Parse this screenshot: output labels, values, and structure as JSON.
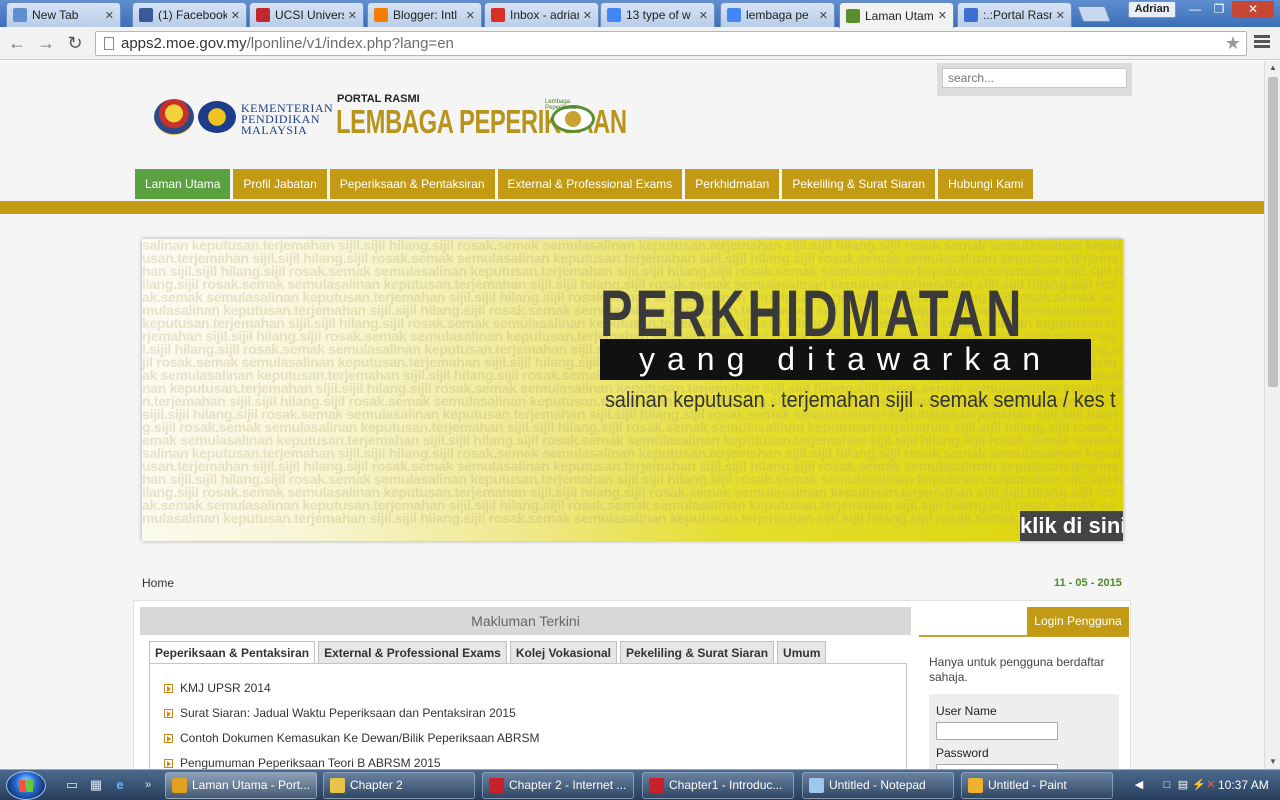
{
  "browser": {
    "tabs": [
      {
        "title": "New Tab",
        "icon": "blank-page-icon",
        "color": "#5f8fd0"
      },
      {
        "title": "(1) Facebook",
        "icon": "facebook-icon",
        "color": "#3b5998"
      },
      {
        "title": "UCSI University",
        "icon": "ucsi-icon",
        "color": "#c0282d"
      },
      {
        "title": "Blogger: Intl",
        "icon": "blogger-icon",
        "color": "#f57d00"
      },
      {
        "title": "Inbox - adrian",
        "icon": "gmail-icon",
        "color": "#d93025"
      },
      {
        "title": "13 type of w",
        "icon": "google-icon",
        "color": "#4285f4"
      },
      {
        "title": "lembaga pe",
        "icon": "google-icon",
        "color": "#4285f4"
      },
      {
        "title": "Laman Utama",
        "icon": "lp-site-icon",
        "color": "#5a8f2e"
      },
      {
        "title": ":.:Portal Rasmi",
        "icon": "loading-icon",
        "color": "#3b6fd0"
      }
    ],
    "active_tab_index": 7,
    "profile_name": "Adrian",
    "url_host": "apps2.moe.gov.my",
    "url_path": "/lponline/v1/index.php?lang=en"
  },
  "site": {
    "logo": {
      "kpm_line1": "KEMENTERIAN",
      "kpm_line2": "PENDIDIKAN",
      "kpm_line3": "MALAYSIA",
      "portal_label": "PORTAL RASMI",
      "org_name": "LEMBAGA PEPERIKSAAN",
      "emblem_text": "Lembaga Peperiksaan"
    },
    "search_placeholder": "search...",
    "nav": [
      "Laman Utama",
      "Profil Jabatan",
      "Peperiksaan & Pentaksiran",
      "External & Professional Exams",
      "Perkhidmatan",
      "Pekeliling & Surat Siaran",
      "Hubungi Kami"
    ],
    "active_nav_index": 0,
    "banner": {
      "title": "PERKHIDMATAN",
      "subtitle": "yang ditawarkan",
      "services": "salinan keputusan . terjemahan sijil . semak semula / kes t",
      "cta": "klik di sini",
      "bg_words": "salinan keputusan.terjemahan sijil.sijil hilang.sijil rosak.semak semula"
    },
    "breadcrumb": "Home",
    "date": "11 - 05 - 2015",
    "news": {
      "header": "Makluman Terkini",
      "tabs": [
        "Peperiksaan & Pentaksiran",
        "External & Professional Exams",
        "Kolej Vokasional",
        "Pekeliling & Surat Siaran",
        "Umum"
      ],
      "active_tab_index": 0,
      "items": [
        "KMJ UPSR 2014",
        "Surat Siaran: Jadual Waktu Peperiksaan dan Pentaksiran 2015",
        "Contoh Dokumen Kemasukan Ke Dewan/Bilik Peperiksaan ABRSM",
        "Pengumuman Peperiksaan Teori B ABRSM 2015"
      ]
    },
    "login": {
      "title": "Login Pengguna",
      "note": "Hanya untuk pengguna berdaftar sahaja.",
      "username_label": "User Name",
      "password_label": "Password"
    }
  },
  "taskbar": {
    "tasks": [
      {
        "label": "Laman Utama - Port...",
        "icon": "chrome-icon",
        "color": "#e0a020"
      },
      {
        "label": "Chapter 2",
        "icon": "folder-icon",
        "color": "#e8c44a"
      },
      {
        "label": "Chapter 2 - Internet ...",
        "icon": "pdf-icon",
        "color": "#c8202a"
      },
      {
        "label": "Chapter1 - Introduc...",
        "icon": "pdf-icon",
        "color": "#c8202a"
      },
      {
        "label": "Untitled - Notepad",
        "icon": "notepad-icon",
        "color": "#9ec8f0"
      },
      {
        "label": "Untitled - Paint",
        "icon": "paint-icon",
        "color": "#f0b030"
      }
    ],
    "active_task_index": 0,
    "clock": "10:37 AM"
  }
}
